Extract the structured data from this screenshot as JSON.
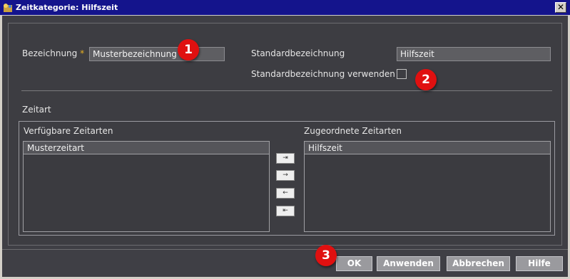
{
  "window": {
    "title": "Zeitkategorie: Hilfszeit",
    "close_glyph": "✕"
  },
  "form": {
    "bezeichnung_label": "Bezeichnung",
    "required_mark": "*",
    "bezeichnung_value": "Musterbezeichnung",
    "standard_label": "Standardbezeichnung",
    "standard_value": "Hilfszeit",
    "use_standard_label": "Standardbezeichnung verwenden",
    "use_standard_checked": false
  },
  "zeitart": {
    "section_label": "Zeitart",
    "available_label": "Verfügbare Zeitarten",
    "available_header": "Musterzeitart",
    "assigned_label": "Zugeordnete Zeitarten",
    "assigned_header": "Hilfszeit",
    "move_buttons": [
      "⇥",
      "→",
      "←",
      "⇤"
    ]
  },
  "buttons": {
    "ok": "OK",
    "apply": "Anwenden",
    "cancel": "Abbrechen",
    "help": "Hilfe"
  },
  "badges": [
    "1",
    "2",
    "3"
  ]
}
